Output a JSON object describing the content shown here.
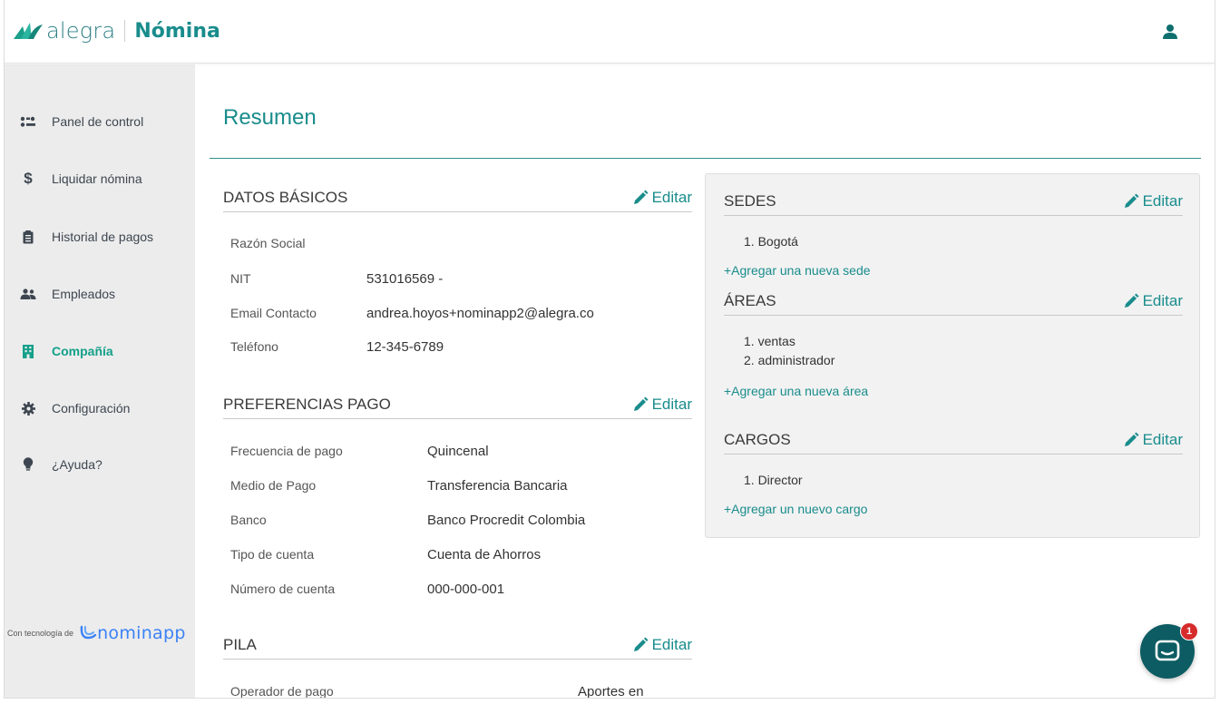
{
  "header": {
    "logo_word": "alegra",
    "product": "Nómina",
    "user_icon": "user-icon"
  },
  "sidebar": {
    "items": [
      {
        "label": "Panel de control",
        "icon": "dashboard-icon",
        "active": false
      },
      {
        "label": "Liquidar nómina",
        "icon": "dollar-icon",
        "active": false
      },
      {
        "label": "Historial de pagos",
        "icon": "clipboard-icon",
        "active": false
      },
      {
        "label": "Empleados",
        "icon": "users-icon",
        "active": false
      },
      {
        "label": "Compañía",
        "icon": "building-icon",
        "active": true
      },
      {
        "label": "Configuración",
        "icon": "gear-icon",
        "active": false
      },
      {
        "label": "¿Ayuda?",
        "icon": "lightbulb-icon",
        "active": false
      }
    ],
    "powered_by": "Con tecnología de",
    "powered_brand": "nominapp"
  },
  "main": {
    "title": "Resumen",
    "edit_label": "Editar",
    "datos_basicos": {
      "title": "DATOS BÁSICOS",
      "rows": [
        {
          "label": "Razón Social",
          "value": ""
        },
        {
          "label": "NIT",
          "value": "531016569 -"
        },
        {
          "label": "Email Contacto",
          "value": "andrea.hoyos+nominapp2@alegra.co"
        },
        {
          "label": "Teléfono",
          "value": "12-345-6789"
        }
      ]
    },
    "preferencias_pago": {
      "title": "PREFERENCIAS PAGO",
      "rows": [
        {
          "label": "Frecuencia de pago",
          "value": "Quincenal"
        },
        {
          "label": "Medio de Pago",
          "value": "Transferencia Bancaria"
        },
        {
          "label": "Banco",
          "value": "Banco Procredit Colombia"
        },
        {
          "label": "Tipo de cuenta",
          "value": "Cuenta de Ahorros"
        },
        {
          "label": "Número de cuenta",
          "value": "000-000-001"
        }
      ]
    },
    "pila": {
      "title": "PILA",
      "rows": [
        {
          "label": "Operador de pago",
          "value": "Aportes en"
        }
      ]
    }
  },
  "card": {
    "sedes": {
      "title": "SEDES",
      "items": [
        "1. Bogotá"
      ],
      "add": "+Agregar una nueva sede"
    },
    "areas": {
      "title": "ÁREAS",
      "items": [
        "1. ventas",
        "2. administrador"
      ],
      "add": "+Agregar una nueva área"
    },
    "cargos": {
      "title": "CARGOS",
      "items": [
        "1. Director"
      ],
      "add": "+Agregar un nuevo cargo"
    }
  },
  "chat": {
    "badge": "1",
    "icon": "chat-icon"
  },
  "colors": {
    "accent": "#1a8c8c",
    "active_nav": "#14a08a",
    "sidebar_bg": "#ececec",
    "chat_bg": "#0d5c63",
    "badge": "#d62c2c"
  }
}
